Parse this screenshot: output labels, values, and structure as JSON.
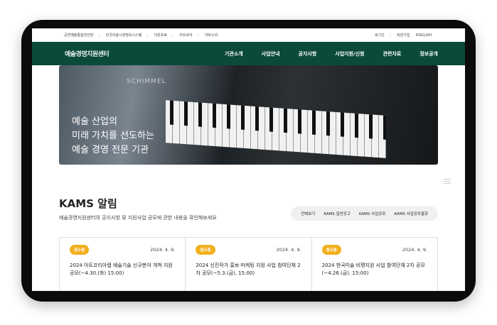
{
  "util_links": [
    "공연예술통합전산망",
    "한국미술시장정보시스템",
    "다원프로",
    "아트모아",
    "아트누리"
  ],
  "account_links": [
    "로그인",
    "회원가입",
    "ENGLISH"
  ],
  "logo": "예술경영지원센터",
  "menu": [
    "기관소개",
    "사업안내",
    "공지사항",
    "사업지원/신청",
    "관련자료",
    "정보공개"
  ],
  "hero": {
    "sign": "SCHIMMEL",
    "line1": "예술 산업의",
    "line2": "미래 가치를 선도하는",
    "line3": "예술 경영 전문 기관"
  },
  "notice": {
    "title": "KAMS 알림",
    "subtitle": "예술경영지원센터의 공지사항 및 지원사업 공모에 관한 내용을 확인해보세요",
    "tabs": [
      "전체보기",
      "KAMS 일반공고",
      "KAMS 사업공모",
      "KAMS 사업공모결과"
    ],
    "cards": [
      {
        "badge": "접수중",
        "date": "2024. 4. 9.",
        "title": "2024 아트코리아랩 예술기술 신규분야 개척 지원 공모(~4.30.(화) 15:00)"
      },
      {
        "badge": "접수중",
        "date": "2024. 4. 9.",
        "title": "2024 신진작가 홍보·마케팅 지원 사업 참여단체 2차 공모(~5.3.(금), 15:00)"
      },
      {
        "badge": "접수중",
        "date": "2024. 4. 9.",
        "title": "2024 한국미술 비평지원 사업 참여단체 2차 공모(~4.26.(금), 15:00)"
      }
    ]
  }
}
